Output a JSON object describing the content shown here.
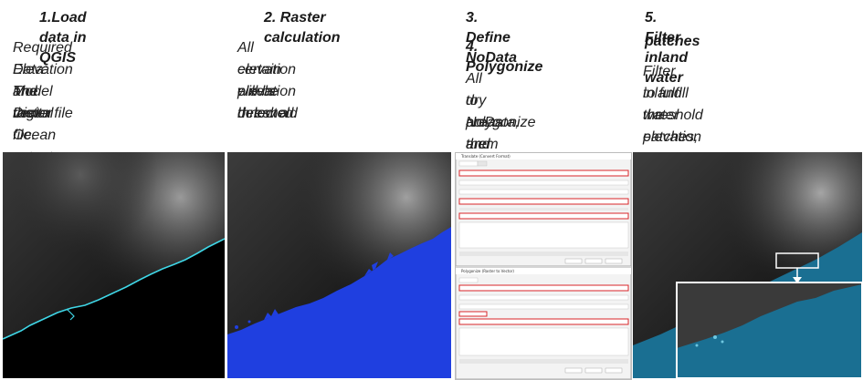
{
  "steps": [
    {
      "title": "1.Load data in QGIS",
      "description": [
        "Required Data: The Digital",
        "Elevation Model raster file",
        "and the Ocean extent",
        "vector file."
      ]
    },
    {
      "title": "2. Raster calculation",
      "description": [
        "All elevation pixels below a",
        "certain elevation threshold",
        "will be detected."
      ]
    },
    {
      "title": "3. Define NoData",
      "title2": "4. Polygonize",
      "description": [
        "All dry areas are set",
        "to NoData, and",
        "polygonize them"
      ]
    },
    {
      "title": "5. Filter inland water",
      "title_line2": "patches",
      "description": [
        "Filter inland water patches,",
        "to fulfill the elevation",
        "threshold"
      ]
    }
  ],
  "colors": {
    "coastline": "#3fd6e6",
    "water_blue": "#1f3fe0",
    "ocean_teal": "#1a6f92",
    "highlight_red": "#d9262a",
    "callout_white": "#ffffff"
  }
}
